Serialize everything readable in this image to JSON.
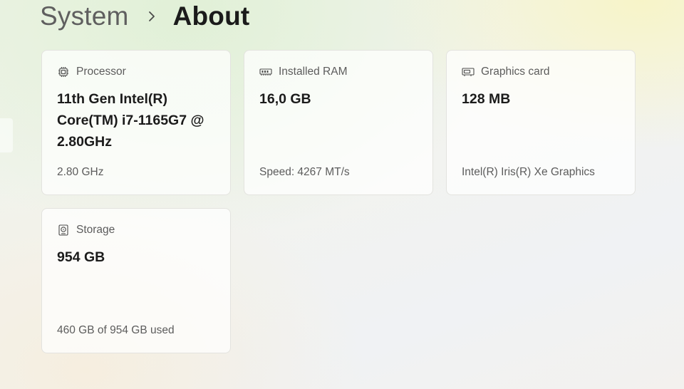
{
  "breadcrumb": {
    "parent": "System",
    "current": "About"
  },
  "cards": {
    "processor": {
      "icon": "processor-icon",
      "title": "Processor",
      "value": "11th Gen Intel(R) Core(TM) i7-1165G7 @ 2.80GHz",
      "sub": "2.80 GHz"
    },
    "ram": {
      "icon": "memory-icon",
      "title": "Installed RAM",
      "value": "16,0 GB",
      "sub": "Speed: 4267 MT/s"
    },
    "gpu": {
      "icon": "graphics-card-icon",
      "title": "Graphics card",
      "value": "128 MB",
      "sub": "Intel(R) Iris(R) Xe Graphics"
    },
    "storage": {
      "icon": "storage-drive-icon",
      "title": "Storage",
      "value": "954 GB",
      "sub": "460 GB of 954 GB used"
    }
  }
}
